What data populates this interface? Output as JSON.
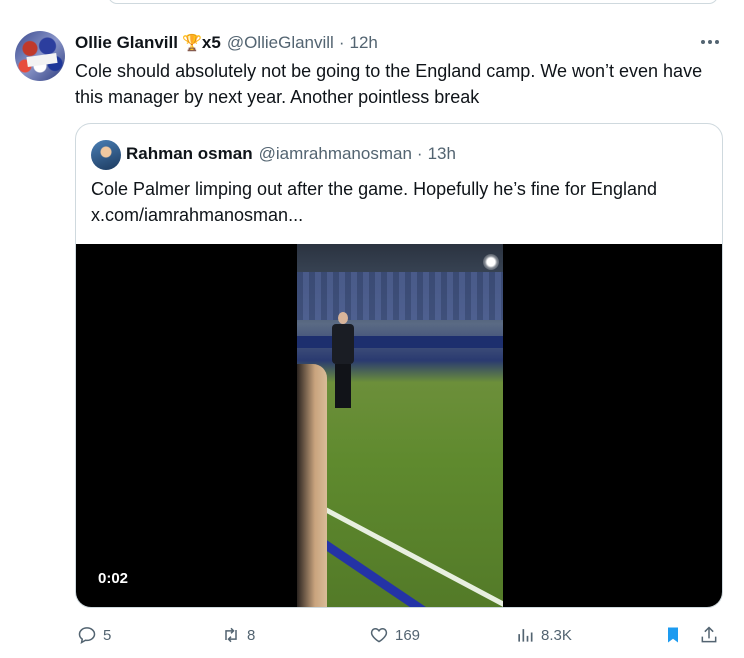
{
  "tweet": {
    "author_name": "Ollie Glanvill",
    "trophy_icon": "🏆",
    "trophy_count": "x5",
    "handle": "@OllieGlanvill",
    "separator": "·",
    "time": "12h",
    "text": "Cole should absolutely not be going to the England camp. We won’t even have this manager by next year. Another pointless break"
  },
  "quote": {
    "author_name": "Rahman osman",
    "handle": "@iamrahmanosman",
    "separator": "·",
    "time": "13h",
    "text_line1": "Cole Palmer limping out after the game. Hopefully he’s fine for England",
    "text_line2": "x.com/iamrahmanosman...",
    "video_duration": "0:02"
  },
  "actions": {
    "replies": "5",
    "reposts": "8",
    "likes": "169",
    "views": "8.3K"
  },
  "colors": {
    "muted": "#536471",
    "bookmark_active": "#1d9bf0",
    "border": "#cfd9de"
  }
}
